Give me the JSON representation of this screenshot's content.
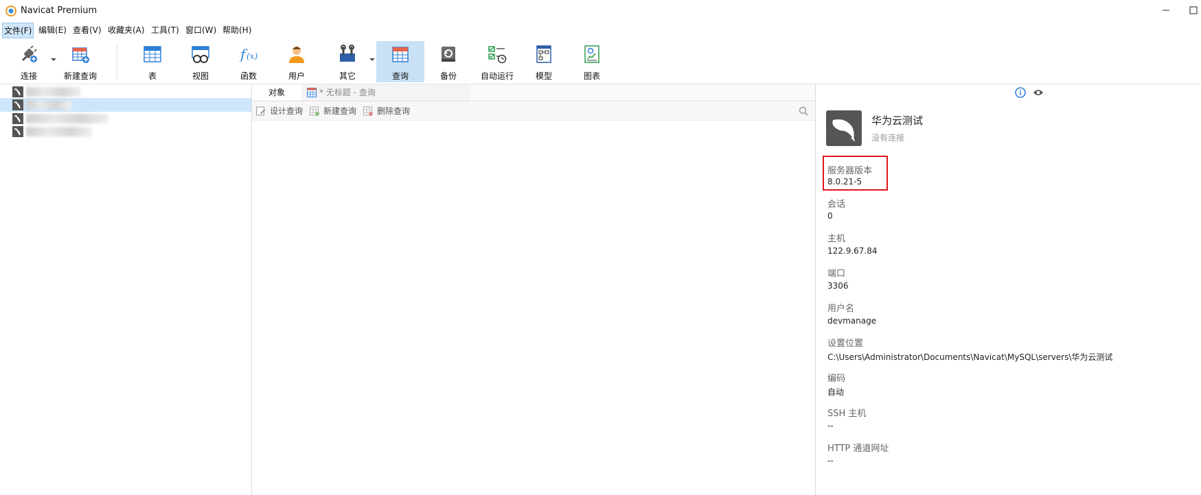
{
  "window": {
    "title": "Navicat Premium"
  },
  "menu": [
    {
      "label": "文件(F)",
      "active": true
    },
    {
      "label": "编辑(E)"
    },
    {
      "label": "查看(V)"
    },
    {
      "label": "收藏夹(A)"
    },
    {
      "label": "工具(T)"
    },
    {
      "label": "窗口(W)"
    },
    {
      "label": "帮助(H)"
    }
  ],
  "toolbar": [
    {
      "label": "连接",
      "icon": "connection-plug-icon"
    },
    {
      "label": "新建查询",
      "icon": "new-query-icon"
    },
    {
      "label": "表",
      "icon": "table-icon"
    },
    {
      "label": "视图",
      "icon": "view-icon"
    },
    {
      "label": "函数",
      "icon": "function-icon"
    },
    {
      "label": "用户",
      "icon": "user-icon"
    },
    {
      "label": "其它",
      "icon": "tools-icon"
    },
    {
      "label": "查询",
      "icon": "query-icon",
      "selected": true
    },
    {
      "label": "备份",
      "icon": "backup-icon"
    },
    {
      "label": "自动运行",
      "icon": "auto-run-icon"
    },
    {
      "label": "模型",
      "icon": "model-icon"
    },
    {
      "label": "图表",
      "icon": "chart-icon"
    }
  ],
  "tabs": {
    "objects": "对象",
    "query": "* 无标题 - 查询"
  },
  "object_actions": [
    {
      "label": "设计查询"
    },
    {
      "label": "新建查询"
    },
    {
      "label": "删除查询"
    }
  ],
  "info": {
    "name": "华为云测试",
    "status": "没有连接",
    "fields": [
      {
        "label": "服务器版本",
        "value": "8.0.21-5"
      },
      {
        "label": "会话",
        "value": "0"
      },
      {
        "label": "主机",
        "value": "122.9.67.84"
      },
      {
        "label": "端口",
        "value": "3306"
      },
      {
        "label": "用户名",
        "value": "devmanage"
      },
      {
        "label": "设置位置",
        "value": "C:\\Users\\Administrator\\Documents\\Navicat\\MySQL\\servers\\华为云测试"
      },
      {
        "label": "编码",
        "value": "自动"
      },
      {
        "label": "SSH 主机",
        "value": "--"
      },
      {
        "label": "HTTP 通道网址",
        "value": "--"
      }
    ]
  },
  "colors": {
    "accent_selected": "#c9e1f6",
    "highlight_border": "#e0161d"
  }
}
